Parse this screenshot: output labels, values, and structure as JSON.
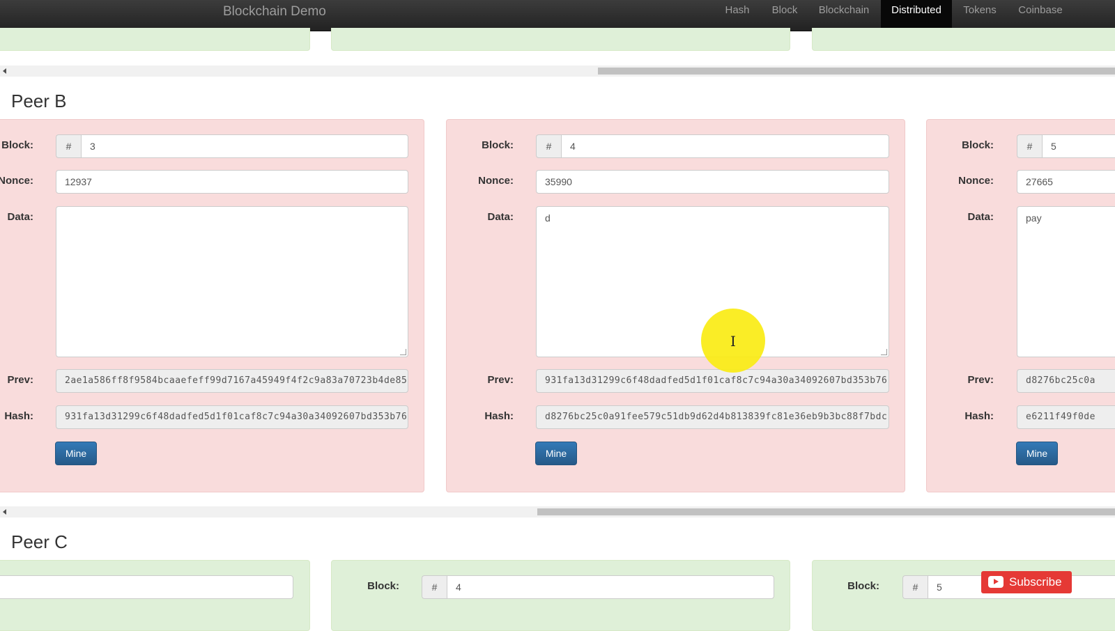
{
  "navbar": {
    "brand": "Blockchain Demo",
    "items": [
      "Hash",
      "Block",
      "Blockchain",
      "Distributed",
      "Tokens",
      "Coinbase"
    ],
    "active": "Distributed"
  },
  "labels": {
    "block": "Block:",
    "nonce": "Nonce:",
    "data": "Data:",
    "prev": "Prev:",
    "hash": "Hash:",
    "hash_sign": "#",
    "mine": "Mine"
  },
  "peer_b": {
    "title": "Peer B",
    "blocks": [
      {
        "block": "3",
        "nonce": "12937",
        "data": "",
        "prev": "2ae1a586ff8f9584bcaaefeff99d7167a45949f4f2c9a83a70723b4de85",
        "hash": "931fa13d31299c6f48dadfed5d1f01caf8c7c94a30a34092607bd353b76"
      },
      {
        "block": "4",
        "nonce": "35990",
        "data": "d",
        "prev": "931fa13d31299c6f48dadfed5d1f01caf8c7c94a30a34092607bd353b76",
        "hash": "d8276bc25c0a91fee579c51db9d62d4b813839fc81e36eb9b3bc88f7bdc"
      },
      {
        "block": "5",
        "nonce": "27665",
        "data": "pay",
        "prev": "d8276bc25c0a",
        "hash": "e6211f49f0de"
      }
    ]
  },
  "peer_c": {
    "title": "Peer C",
    "blocks": [
      {
        "block": "4"
      },
      {
        "block": "5"
      }
    ]
  },
  "overlay": {
    "subscribe_label": "Subscribe"
  },
  "colors": {
    "peer_b_card": "#f9dcdc",
    "peer_c_card": "#dff0d8",
    "mine_button": "#337ab7",
    "cursor_highlight": "#faeb14"
  }
}
